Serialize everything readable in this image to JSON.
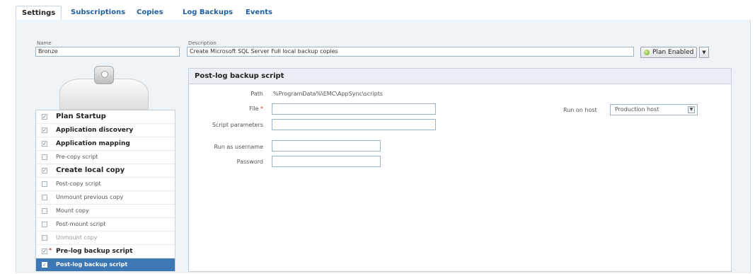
{
  "tabs": [
    "Settings",
    "Subscriptions",
    "Copies",
    "Log Backups",
    "Events"
  ],
  "name": {
    "label": "Name",
    "value": "Bronze"
  },
  "description": {
    "label": "Description",
    "value": "Create Microsoft SQL Server Full local backup copies"
  },
  "plan_button": "Plan Enabled",
  "steps": [
    {
      "label": "Plan Startup",
      "checked": true
    },
    {
      "label": "Application discovery",
      "checked": true
    },
    {
      "label": "Application mapping",
      "checked": true
    },
    {
      "label": "Pre-copy script",
      "checked": false
    },
    {
      "label": "Create local copy",
      "checked": true
    },
    {
      "label": "Post-copy script",
      "checked": false
    },
    {
      "label": "Unmount previous copy",
      "checked": false
    },
    {
      "label": "Mount copy",
      "checked": false
    },
    {
      "label": "Post-mount script",
      "checked": false
    },
    {
      "label": "Unmount copy",
      "checked": false
    },
    {
      "label": "Pre-log backup script",
      "checked": true
    },
    {
      "label": "Post-log backup script",
      "checked": true
    }
  ],
  "script": {
    "title": "Post-log backup script",
    "path_label": "Path",
    "path_value": "%ProgramData%\\EMC\\AppSync\\scripts",
    "file_label": "File",
    "params_label": "Script parameters",
    "user_label": "Run as username",
    "password_label": "Password",
    "run_on_label": "Run on host",
    "run_on_value": "Production host"
  },
  "icons": {
    "plan": "plan-enabled-icon",
    "dropdown": "chevron-down-icon"
  },
  "colors": {
    "accent": "#3d78b5",
    "tab_text": "#1f5f9f",
    "required": "#d9352d"
  }
}
